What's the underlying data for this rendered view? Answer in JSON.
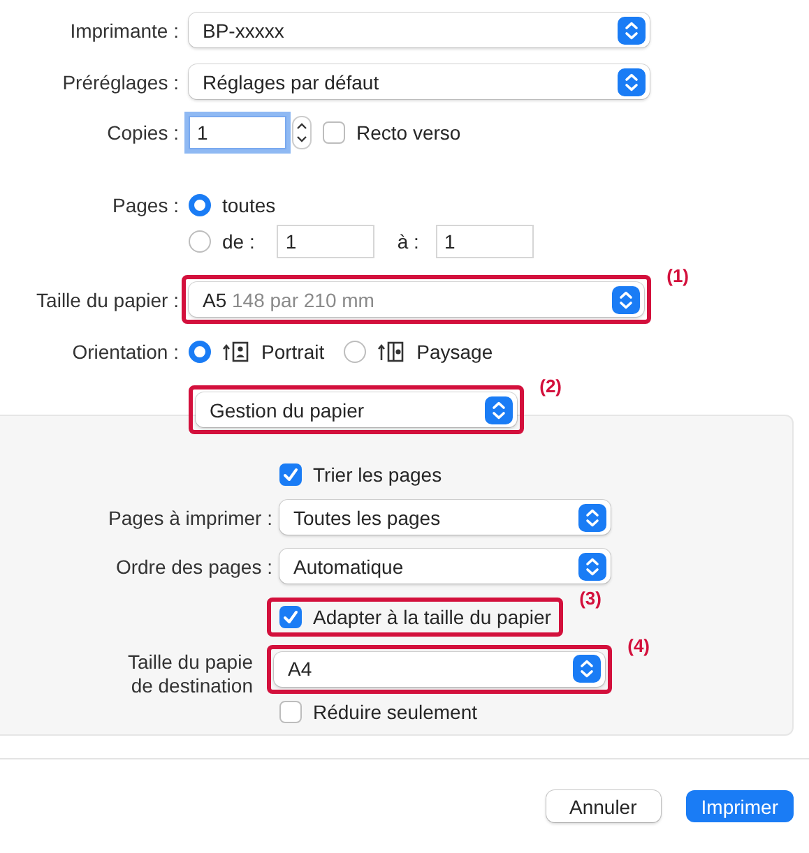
{
  "printer": {
    "label": "Imprimante :",
    "value": "BP-xxxxx"
  },
  "presets": {
    "label": "Préréglages :",
    "value": "Réglages par défaut"
  },
  "copies": {
    "label": "Copies :",
    "value": "1",
    "duplex": {
      "label": "Recto verso",
      "checked": false
    }
  },
  "pages": {
    "label": "Pages :",
    "options": [
      {
        "label": "toutes",
        "selected": true
      },
      {
        "label": "de :",
        "selected": false
      }
    ],
    "from": "1",
    "to_label": "à :",
    "to": "1"
  },
  "paper_size": {
    "label": "Taille du papier :",
    "value": "A5",
    "detail": "148 par 210 mm",
    "callout": "(1)"
  },
  "orientation": {
    "label": "Orientation :",
    "options": [
      {
        "label": "Portrait",
        "kind": "portrait",
        "selected": true
      },
      {
        "label": "Paysage",
        "kind": "landscape",
        "selected": false
      }
    ]
  },
  "section_menu": {
    "value": "Gestion du papier",
    "callout": "(2)"
  },
  "panel": {
    "collate": {
      "label": "Trier les pages",
      "checked": true
    },
    "pages_to_print": {
      "label": "Pages à imprimer :",
      "value": "Toutes les pages"
    },
    "page_order": {
      "label": "Ordre des pages :",
      "value": "Automatique"
    },
    "scale_to_fit": {
      "label": "Adapter à la taille du papier",
      "checked": true,
      "callout": "(3)"
    },
    "destination_size": {
      "label_lines": [
        "Taille du papie",
        "de destination"
      ],
      "value": "A4",
      "callout": "(4)"
    },
    "reduce_only": {
      "label": "Réduire seulement",
      "checked": false
    }
  },
  "buttons": [
    {
      "label": "Annuler",
      "kind": "secondary"
    },
    {
      "label": "Imprimer",
      "kind": "primary"
    }
  ]
}
